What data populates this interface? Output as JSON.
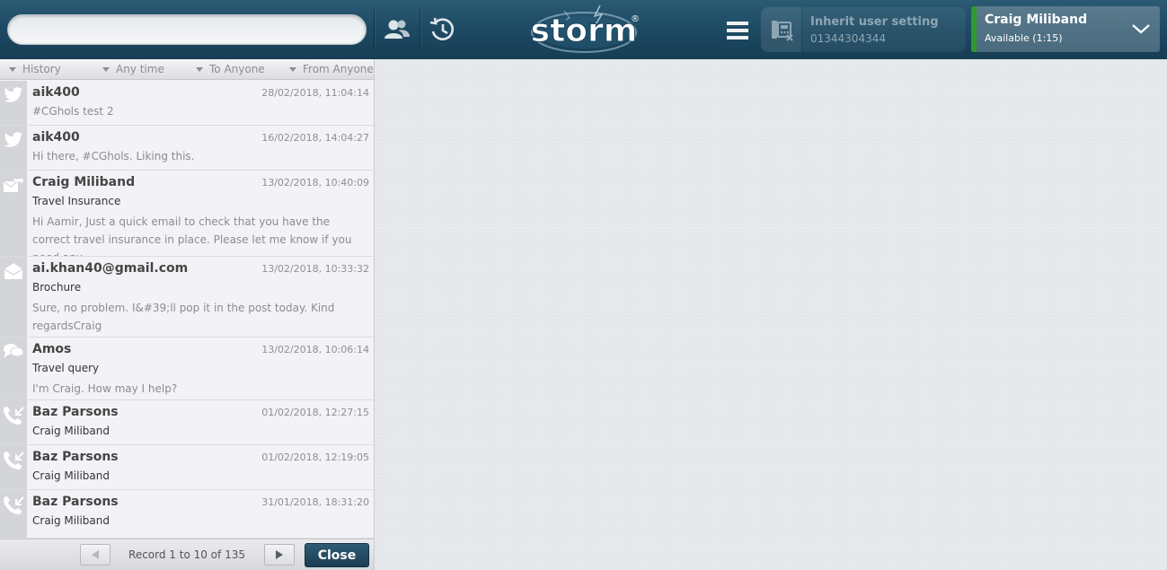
{
  "header": {
    "search_placeholder": "",
    "logo_text": "storm",
    "logo_mark": "®",
    "phone": {
      "label": "Inherit user setting",
      "number": "01344304344"
    },
    "user": {
      "name": "Craig Miliband",
      "status": "Available (1:15)",
      "status_color": "#2f9a2f"
    }
  },
  "filters": {
    "history": "History",
    "time": "Any time",
    "to": "To Anyone",
    "from": "From Anyone"
  },
  "items": [
    {
      "icon": "twitter-icon",
      "name": "aik400",
      "date": "28/02/2018, 11:04:14",
      "line1": "#CGhols test 2",
      "preview": ""
    },
    {
      "icon": "twitter-icon",
      "name": "aik400",
      "date": "16/02/2018, 14:04:27",
      "line1": "Hi there, #CGhols. Liking this.",
      "preview": ""
    },
    {
      "icon": "email-forward-icon",
      "name": "Craig Miliband",
      "date": "13/02/2018, 10:40:09",
      "line1": "Travel Insurance",
      "preview": "Hi Aamir, Just a quick email to check that you have the correct travel insurance in place. Please let me know if you need any"
    },
    {
      "icon": "email-open-icon",
      "name": "ai.khan40@gmail.com",
      "date": "13/02/2018, 10:33:32",
      "line1": "Brochure",
      "preview": "Sure, no problem. I&#39;ll pop it in the post today. Kind regardsCraig"
    },
    {
      "icon": "chat-icon",
      "name": "Amos",
      "date": "13/02/2018, 10:06:14",
      "line1": "Travel query",
      "preview": "I'm Craig. How may I help?"
    },
    {
      "icon": "call-incoming-icon",
      "name": "Baz Parsons",
      "date": "01/02/2018, 12:27:15",
      "line1": "Craig Miliband",
      "preview": ""
    },
    {
      "icon": "call-incoming-icon",
      "name": "Baz Parsons",
      "date": "01/02/2018, 12:19:05",
      "line1": "Craig Miliband",
      "preview": ""
    },
    {
      "icon": "call-incoming-icon",
      "name": "Baz Parsons",
      "date": "31/01/2018, 18:31:20",
      "line1": "Craig Miliband",
      "preview": ""
    }
  ],
  "pager": {
    "record_text": "Record 1 to 10 of 135",
    "close_label": "Close"
  },
  "colors": {
    "header_bg": "#1d4a63",
    "accent_button": "#1f4a61",
    "status_available": "#2f9a2f"
  }
}
